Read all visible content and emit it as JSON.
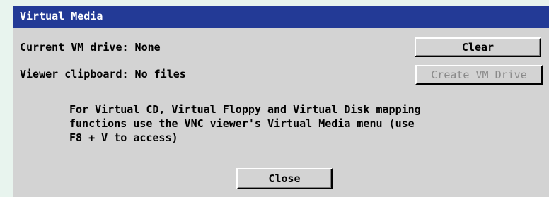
{
  "dialog": {
    "title": "Virtual Media",
    "current_drive_label": "Current VM drive: None",
    "clipboard_label": "Viewer clipboard: No files",
    "clear_button": "Clear",
    "create_button": "Create VM Drive",
    "info_lines": [
      "For Virtual CD, Virtual Floppy and Virtual Disk mapping",
      "functions use the VNC viewer's Virtual Media menu (use",
      "F8 + V to access)"
    ],
    "close_button": "Close"
  },
  "colors": {
    "titlebar": "#233a96",
    "dialog_bg": "#d3d3d3",
    "page_bg": "#e8f4ee",
    "disabled_text": "#8a8a8a"
  }
}
